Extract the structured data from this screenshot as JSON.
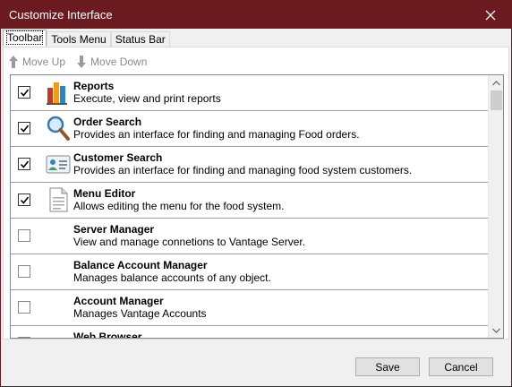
{
  "window": {
    "title": "Customize Interface"
  },
  "tabs": [
    {
      "label": "Toolbar",
      "active": true
    },
    {
      "label": "Tools Menu",
      "active": false
    },
    {
      "label": "Status Bar",
      "active": false
    }
  ],
  "toolstrip": {
    "move_up_label": "Move Up",
    "move_down_label": "Move Down"
  },
  "items": [
    {
      "name": "Reports",
      "description": "Execute, view and print reports",
      "checked": true,
      "icon": "reports-chart-icon"
    },
    {
      "name": "Order Search",
      "description": "Provides an interface for finding and managing Food orders.",
      "checked": true,
      "icon": "magnifier-icon"
    },
    {
      "name": "Customer Search",
      "description": "Provides an interface for finding and managing food system customers.",
      "checked": true,
      "icon": "customer-card-icon"
    },
    {
      "name": "Menu Editor",
      "description": "Allows editing the menu for the food system.",
      "checked": true,
      "icon": "document-icon"
    },
    {
      "name": "Server Manager",
      "description": "View and manage connetions to Vantage Server.",
      "checked": false,
      "icon": ""
    },
    {
      "name": "Balance Account Manager",
      "description": "Manages balance accounts of any object.",
      "checked": false,
      "icon": ""
    },
    {
      "name": "Account Manager",
      "description": "Manages Vantage Accounts",
      "checked": false,
      "icon": ""
    },
    {
      "name": "Web Browser",
      "description": "",
      "checked": false,
      "icon": ""
    }
  ],
  "footer": {
    "save_label": "Save",
    "cancel_label": "Cancel"
  },
  "colors": {
    "titlebar": "#6b1a1f",
    "list_border": "#828790"
  }
}
